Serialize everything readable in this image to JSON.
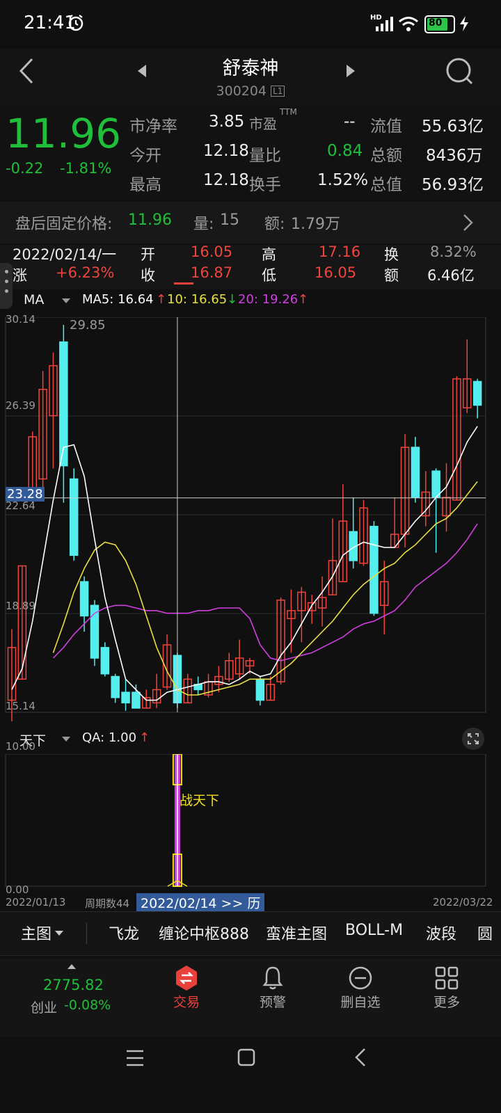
{
  "status": {
    "time": "21:41",
    "battery": "80",
    "signal_label": "HD"
  },
  "header": {
    "title": "舒泰神",
    "code": "300204",
    "level_badge": "L1"
  },
  "quote": {
    "price": "11.96",
    "change": "-0.22",
    "change_pct": "-1.81%",
    "fields": [
      {
        "label": "市净率",
        "value": "3.85"
      },
      {
        "label": "市盈",
        "sup": "TTM",
        "value": "--"
      },
      {
        "label": "流值",
        "value": "55.63亿"
      },
      {
        "label": "今开",
        "value": "12.18"
      },
      {
        "label": "量比",
        "value": "0.84"
      },
      {
        "label": "总额",
        "value": "8436万"
      },
      {
        "label": "最高",
        "value": "12.18"
      },
      {
        "label": "换手",
        "value": "1.52%"
      },
      {
        "label": "总值",
        "value": "56.93亿"
      }
    ]
  },
  "after_hours": {
    "label": "盘后固定价格:",
    "price": "11.96",
    "vol_label": "量:",
    "vol": "15",
    "amt_label": "额:",
    "amt": "1.79万"
  },
  "ohlc": {
    "date": "2022/02/14/一",
    "open_label": "开",
    "open": "16.05",
    "high_label": "高",
    "high": "17.16",
    "turn_label": "换",
    "turn": "8.32%",
    "chg_label": "涨",
    "chg": "+6.23%",
    "close_label": "收",
    "close": "16.87",
    "low_label": "低",
    "low": "16.05",
    "amt_label": "额",
    "amt": "6.46亿"
  },
  "ma": {
    "name": "MA",
    "ma5_label": "MA5: 16.64",
    "ma10_label": "10: 16.65",
    "ma20_label": "20: 19.26",
    "ma5_color": "#ffffff",
    "ma10_color": "#e8e040",
    "ma20_color": "#d040e0"
  },
  "chart_data": {
    "type": "candlestick",
    "y_labels": [
      "30.14",
      "26.39",
      "22.64",
      "18.89",
      "15.14"
    ],
    "max_label": "29.85",
    "crosshair_label": "23.28",
    "x_start": "2022/01/13",
    "x_end": "2022/03/22",
    "candles": [
      {
        "o": 15.6,
        "c": 17.6,
        "h": 18.3,
        "l": 14.8
      },
      {
        "o": 16.4,
        "c": 20.7,
        "h": 20.7,
        "l": 16.4
      },
      {
        "o": 23.5,
        "c": 25.6,
        "h": 25.8,
        "l": 23.1
      },
      {
        "o": 24.0,
        "c": 27.4,
        "h": 28.1,
        "l": 23.2
      },
      {
        "o": 26.4,
        "c": 28.3,
        "h": 28.8,
        "l": 24.4
      },
      {
        "o": 29.2,
        "c": 24.5,
        "h": 29.85,
        "l": 23.1
      },
      {
        "o": 24.0,
        "c": 21.1,
        "h": 24.4,
        "l": 20.9
      },
      {
        "o": 20.1,
        "c": 18.8,
        "h": 20.3,
        "l": 18.2
      },
      {
        "o": 19.2,
        "c": 17.2,
        "h": 19.4,
        "l": 16.9
      },
      {
        "o": 17.6,
        "c": 16.6,
        "h": 17.8,
        "l": 16.5
      },
      {
        "o": 16.5,
        "c": 15.7,
        "h": 16.6,
        "l": 15.5
      },
      {
        "o": 15.9,
        "c": 15.5,
        "h": 16.4,
        "l": 15.2
      },
      {
        "o": 15.9,
        "c": 15.3,
        "h": 16.2,
        "l": 15.3
      },
      {
        "o": 15.3,
        "c": 15.7,
        "h": 16.0,
        "l": 15.3
      },
      {
        "o": 15.5,
        "c": 16.0,
        "h": 16.6,
        "l": 15.3
      },
      {
        "o": 16.1,
        "c": 17.7,
        "h": 18.1,
        "l": 16.0
      },
      {
        "o": 17.3,
        "c": 15.5,
        "h": 17.4,
        "l": 15.3
      },
      {
        "o": 15.5,
        "c": 16.4,
        "h": 16.6,
        "l": 15.5
      },
      {
        "o": 16.2,
        "c": 16.0,
        "h": 16.5,
        "l": 15.8
      },
      {
        "o": 15.8,
        "c": 16.3,
        "h": 16.6,
        "l": 15.7
      },
      {
        "o": 16.2,
        "c": 16.5,
        "h": 16.9,
        "l": 15.9
      },
      {
        "o": 16.4,
        "c": 17.1,
        "h": 17.4,
        "l": 16.3
      },
      {
        "o": 16.6,
        "c": 17.2,
        "h": 17.9,
        "l": 16.4
      },
      {
        "o": 16.9,
        "c": 17.1,
        "h": 17.2,
        "l": 16.6
      },
      {
        "o": 16.4,
        "c": 15.6,
        "h": 16.5,
        "l": 15.4
      },
      {
        "o": 15.6,
        "c": 16.2,
        "h": 16.5,
        "l": 15.6
      },
      {
        "o": 16.3,
        "c": 19.4,
        "h": 19.5,
        "l": 16.2
      },
      {
        "o": 18.7,
        "c": 19.0,
        "h": 19.8,
        "l": 17.4
      },
      {
        "o": 19.0,
        "c": 19.7,
        "h": 19.9,
        "l": 17.8
      },
      {
        "o": 19.0,
        "c": 19.3,
        "h": 19.6,
        "l": 18.5
      },
      {
        "o": 19.1,
        "c": 19.5,
        "h": 20.3,
        "l": 18.4
      },
      {
        "o": 19.6,
        "c": 20.9,
        "h": 22.5,
        "l": 19.6
      },
      {
        "o": 20.1,
        "c": 22.4,
        "h": 23.8,
        "l": 20.1
      },
      {
        "o": 22.0,
        "c": 20.9,
        "h": 23.3,
        "l": 20.6
      },
      {
        "o": 20.8,
        "c": 22.9,
        "h": 23.2,
        "l": 20.7
      },
      {
        "o": 22.2,
        "c": 18.9,
        "h": 22.4,
        "l": 18.8
      },
      {
        "o": 19.2,
        "c": 20.1,
        "h": 20.9,
        "l": 18.1
      },
      {
        "o": 21.4,
        "c": 21.9,
        "h": 23.3,
        "l": 21.4
      },
      {
        "o": 21.9,
        "c": 25.2,
        "h": 25.7,
        "l": 21.4
      },
      {
        "o": 25.2,
        "c": 23.3,
        "h": 25.6,
        "l": 23.1
      },
      {
        "o": 22.6,
        "c": 23.5,
        "h": 24.3,
        "l": 22.2
      },
      {
        "o": 24.3,
        "c": 23.3,
        "h": 24.4,
        "l": 21.2
      },
      {
        "o": 22.6,
        "c": 23.3,
        "h": 24.6,
        "l": 22.0
      },
      {
        "o": 23.2,
        "c": 27.8,
        "h": 27.9,
        "l": 23.2
      },
      {
        "o": 26.7,
        "c": 27.8,
        "h": 29.3,
        "l": 26.5
      },
      {
        "o": 27.7,
        "c": 26.8,
        "h": 27.8,
        "l": 26.3
      }
    ],
    "ma5": [
      16.0,
      16.8,
      18.6,
      20.9,
      23.2,
      25.2,
      25.3,
      24.1,
      21.7,
      19.5,
      17.9,
      16.4,
      16.0,
      15.6,
      15.6,
      15.9,
      16.0,
      16.1,
      16.2,
      16.3,
      16.3,
      16.2,
      16.4,
      16.7,
      16.5,
      16.6,
      17.3,
      17.8,
      18.5,
      19.2,
      19.7,
      20.3,
      21.1,
      21.4,
      21.6,
      21.5,
      21.4,
      21.4,
      21.9,
      22.4,
      22.8,
      23.3,
      23.7,
      24.5,
      25.4,
      26.0
    ],
    "ma10": [
      null,
      null,
      null,
      null,
      17.4,
      18.5,
      19.7,
      20.6,
      21.3,
      21.6,
      21.5,
      20.9,
      20.0,
      18.8,
      17.6,
      16.7,
      16.0,
      15.8,
      15.8,
      15.9,
      16.0,
      16.1,
      16.2,
      16.4,
      16.4,
      16.4,
      16.7,
      17.0,
      17.4,
      17.8,
      18.2,
      18.6,
      19.1,
      19.6,
      20.0,
      20.3,
      20.6,
      20.8,
      21.2,
      21.5,
      21.9,
      22.3,
      22.5,
      22.9,
      23.4,
      23.9
    ],
    "ma20": [
      null,
      null,
      null,
      null,
      17.2,
      17.6,
      18.1,
      18.5,
      18.9,
      19.1,
      19.2,
      19.2,
      19.1,
      19.0,
      19.0,
      18.9,
      18.9,
      18.9,
      19.0,
      19.0,
      19.1,
      19.1,
      19.1,
      18.7,
      17.7,
      17.2,
      17.1,
      17.2,
      17.3,
      17.4,
      17.6,
      17.8,
      18.0,
      18.3,
      18.5,
      18.6,
      18.8,
      19.0,
      19.4,
      19.9,
      20.2,
      20.5,
      20.8,
      21.2,
      21.7,
      22.3
    ],
    "price_range": [
      15.14,
      30.14
    ],
    "indicator": {
      "name": "天下",
      "qa_label": "QA: 1.00",
      "y_max": "10.00",
      "y_min": "0.00",
      "signal_text": "战天下",
      "period_label": "周期数44",
      "date_tag": "2022/02/14 >> 历",
      "signal_index": 16,
      "signal_value": 10
    }
  },
  "tabs": [
    "主图",
    "飞龙",
    "缠论中枢888",
    "蛮准主图",
    "BOLL-M",
    "波段",
    "圆"
  ],
  "bottom_nav": {
    "index_value": "2775.82",
    "index_name": "创业",
    "index_change": "-0.08%",
    "items": [
      {
        "label": "交易",
        "icon": "trade-icon"
      },
      {
        "label": "预警",
        "icon": "bell-icon"
      },
      {
        "label": "删自选",
        "icon": "minus-circle-icon"
      },
      {
        "label": "更多",
        "icon": "grid-icon"
      }
    ]
  },
  "colors": {
    "up": "#f0443c",
    "down": "#55eeee",
    "accent": "#e8403a"
  }
}
